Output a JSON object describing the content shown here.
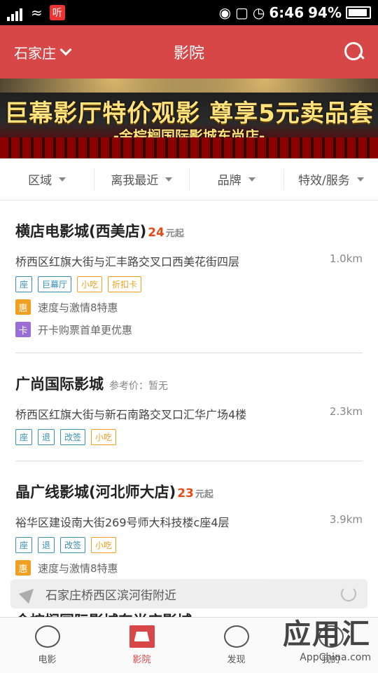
{
  "status": {
    "time": "6:46",
    "battery": "94%",
    "ting": "听"
  },
  "header": {
    "city": "石家庄",
    "title": "影院"
  },
  "banner": {
    "line1": "巨幕影厅特价观影 尊享5元卖品套餐",
    "line2": "-金棕榈国际影城东尚店-"
  },
  "filters": [
    {
      "label": "区域"
    },
    {
      "label": "离我最近"
    },
    {
      "label": "品牌"
    },
    {
      "label": "特效/服务"
    }
  ],
  "cinemas": [
    {
      "name": "横店电影城(西美店)",
      "price": "24",
      "price_suffix": "元起",
      "address": "桥西区红旗大街与汇丰路交叉口西美花街四层",
      "distance": "1.0km",
      "tags": [
        {
          "t": "座"
        },
        {
          "t": "巨幕厅"
        },
        {
          "t": "小吃"
        },
        {
          "t": "折扣卡"
        }
      ],
      "promos": [
        {
          "badge": "惠",
          "text": "速度与激情8特惠"
        },
        {
          "badge": "卡",
          "text": "开卡购票首单更优惠"
        }
      ]
    },
    {
      "name": "广尚国际影城",
      "ref": "参考价：暂无",
      "address": "桥西区红旗大街与新石南路交叉口汇华广场4楼",
      "distance": "2.3km",
      "tags": [
        {
          "t": "座"
        },
        {
          "t": "退"
        },
        {
          "t": "改签"
        },
        {
          "t": "小吃"
        }
      ]
    },
    {
      "name": "晶广线影城(河北师大店)",
      "price": "23",
      "price_suffix": "元起",
      "address": "裕华区建设南大街269号师大科技楼c座4层",
      "distance": "3.9km",
      "tags": [
        {
          "t": "座"
        },
        {
          "t": "退"
        },
        {
          "t": "改签"
        },
        {
          "t": "小吃"
        }
      ],
      "promos": [
        {
          "badge": "惠",
          "text": "速度与激情8特惠"
        }
      ]
    }
  ],
  "location_bar": {
    "text": "石家庄桥西区滨河街附近"
  },
  "peek_row": "金棕榈国际影城东尚店影城",
  "tabs": [
    {
      "label": "电影"
    },
    {
      "label": "影院"
    },
    {
      "label": "发现"
    },
    {
      "label": "我的"
    }
  ],
  "watermark": {
    "brand": "应用汇",
    "url": "AppChina.com"
  }
}
